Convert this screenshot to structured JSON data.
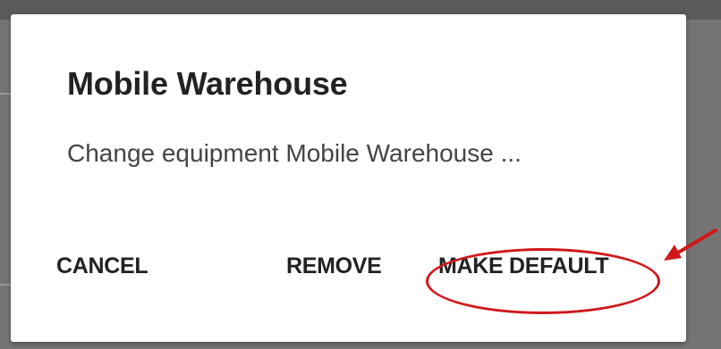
{
  "dialog": {
    "title": "Mobile Warehouse",
    "message": "Change equipment Mobile Warehouse ...",
    "buttons": {
      "cancel_label": "CANCEL",
      "remove_label": "REMOVE",
      "make_default_label": "MAKE DEFAULT"
    }
  },
  "annotation": {
    "color": "#d0181b",
    "icon": "red-arrow-icon",
    "highlight": "red-ellipse-highlight"
  },
  "colors": {
    "dialog_background": "#ffffff",
    "backdrop": "#747474",
    "text_primary": "#222222",
    "text_secondary": "#444444"
  }
}
